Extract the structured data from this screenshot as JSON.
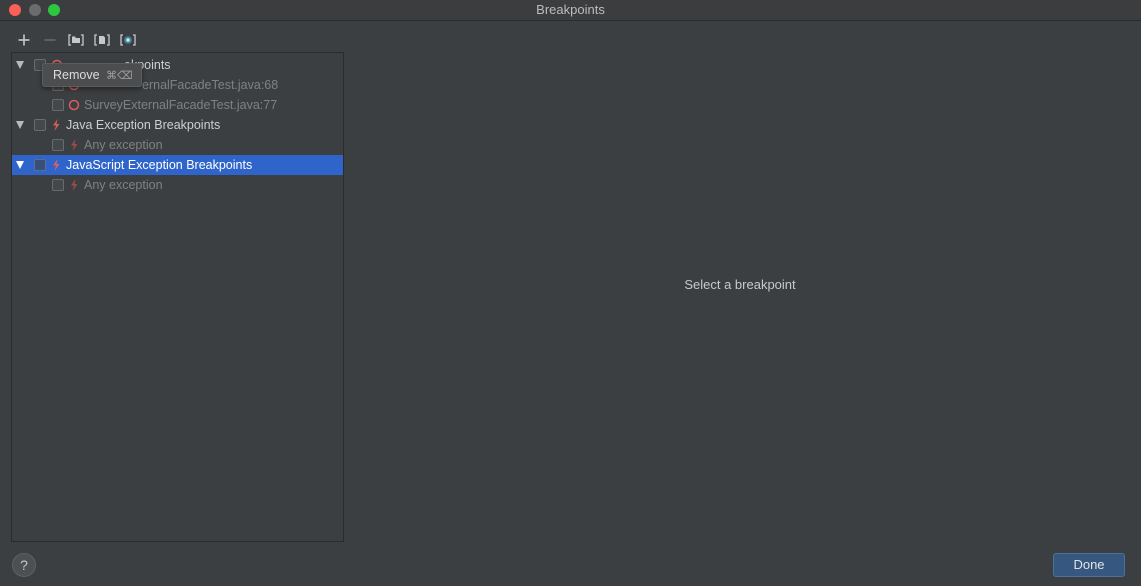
{
  "window": {
    "title": "Breakpoints"
  },
  "toolbar": {
    "add_icon": "plus-icon",
    "remove_icon": "minus-icon",
    "group_by_package_icon": "group-by-package-icon",
    "group_by_file_icon": "group-by-file-icon",
    "group_by_class_icon": "group-by-class-icon"
  },
  "tooltip": {
    "label": "Remove",
    "shortcut": "⌘⌫"
  },
  "tree": {
    "groups": [
      {
        "label": "Line Breakpoints",
        "visible_label": "akpoints",
        "icon": "line-breakpoint-icon",
        "children": [
          {
            "label": "SurveyExternalFacadeTest.java:68",
            "visible_label": "ernalFacadeTest.java:68",
            "icon": "line-breakpoint-icon"
          },
          {
            "label": "SurveyExternalFacadeTest.java:77",
            "icon": "line-breakpoint-icon"
          }
        ]
      },
      {
        "label": "Java Exception Breakpoints",
        "icon": "exception-breakpoint-icon",
        "children": [
          {
            "label": "Any exception",
            "icon": "exception-breakpoint-icon"
          }
        ]
      },
      {
        "label": "JavaScript Exception Breakpoints",
        "icon": "exception-breakpoint-icon",
        "selected": true,
        "children": [
          {
            "label": "Any exception",
            "icon": "exception-breakpoint-icon"
          }
        ]
      }
    ]
  },
  "detail": {
    "empty_message": "Select a breakpoint"
  },
  "footer": {
    "help_label": "?",
    "done_label": "Done"
  },
  "colors": {
    "background": "#3c3f41",
    "selection": "#2f65ca",
    "breakpoint_red": "#db5c5c",
    "done_button": "#365880"
  }
}
